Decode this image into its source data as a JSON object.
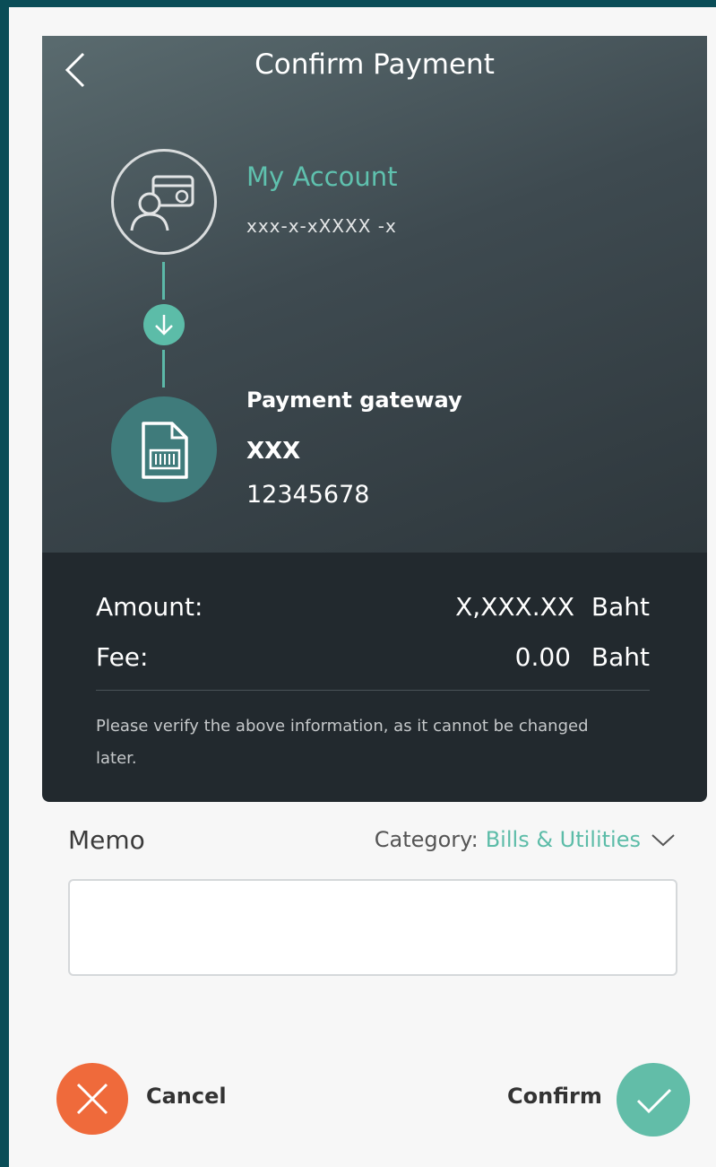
{
  "header": {
    "title": "Confirm Payment",
    "back_icon": "chevron-left-icon"
  },
  "from": {
    "name": "My Account",
    "account_number": "xxx-x-xXXXX -x",
    "icon": "account-card-icon"
  },
  "to": {
    "title": "Payment gateway",
    "name": "XXX",
    "number": "12345678",
    "icon": "bill-document-icon"
  },
  "summary": {
    "amount_label": "Amount:",
    "amount_value": "X,XXX.XX",
    "amount_unit": "Baht",
    "fee_label": "Fee:",
    "fee_value": "0.00",
    "fee_unit": "Baht",
    "note": "Please verify the above information, as it cannot be changed later."
  },
  "memo": {
    "label": "Memo",
    "value": "",
    "category_label": "Category:",
    "category_value": "Bills & Utilities"
  },
  "actions": {
    "cancel_label": "Cancel",
    "confirm_label": "Confirm"
  },
  "colors": {
    "accent": "#5cbca8",
    "cancel": "#ef6a3b",
    "header_bg": "#3e4a50",
    "summary_bg": "#22292e"
  }
}
